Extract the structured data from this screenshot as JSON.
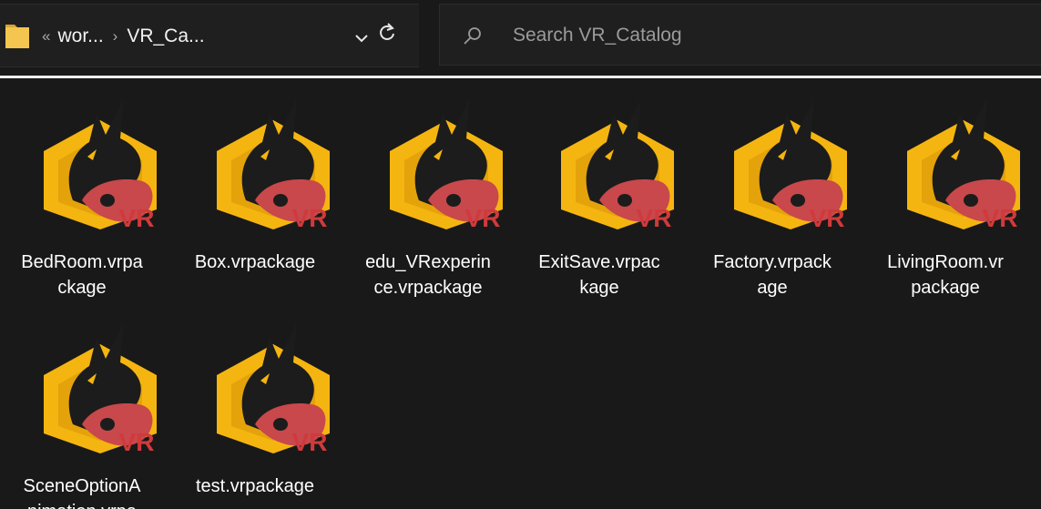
{
  "address": {
    "overflow_glyph": "«",
    "crumbs": [
      "wor...",
      "VR_Ca..."
    ],
    "separator": "›"
  },
  "search": {
    "placeholder": "Search VR_Catalog",
    "value": ""
  },
  "icons": {
    "folder": "folder-icon",
    "dropdown": "chevron-down-icon",
    "refresh": "refresh-icon",
    "search": "search-icon",
    "file_thumbnail": "vr-package-icon"
  },
  "colors": {
    "background": "#191919",
    "hex_yellow": "#f5b510",
    "dragon": "#1c1c1c",
    "headset_red": "#c8484c",
    "vr_text": "#d03a3c",
    "focus_line": "#ededed"
  },
  "files": [
    {
      "name": "BedRoom.vrpackage",
      "line1": "BedRoom.vrpa",
      "line2": "ckage"
    },
    {
      "name": "Box.vrpackage",
      "line1": "Box.vrpackage",
      "line2": ""
    },
    {
      "name": "edu_VRexperince.vrpackage",
      "line1": "edu_VRexperin",
      "line2": "ce.vrpackage"
    },
    {
      "name": "ExitSave.vrpackage",
      "line1": "ExitSave.vrpac",
      "line2": "kage"
    },
    {
      "name": "Factory.vrpackage",
      "line1": "Factory.vrpack",
      "line2": "age"
    },
    {
      "name": "LivingRoom.vrpackage",
      "line1": "LivingRoom.vr",
      "line2": "package"
    },
    {
      "name": "SceneOptionAnimation.vrpackage",
      "line1": "SceneOptionA",
      "line2": "nimation.vrpa"
    },
    {
      "name": "test.vrpackage",
      "line1": "test.vrpackage",
      "line2": ""
    }
  ],
  "thumb_label": "VR"
}
